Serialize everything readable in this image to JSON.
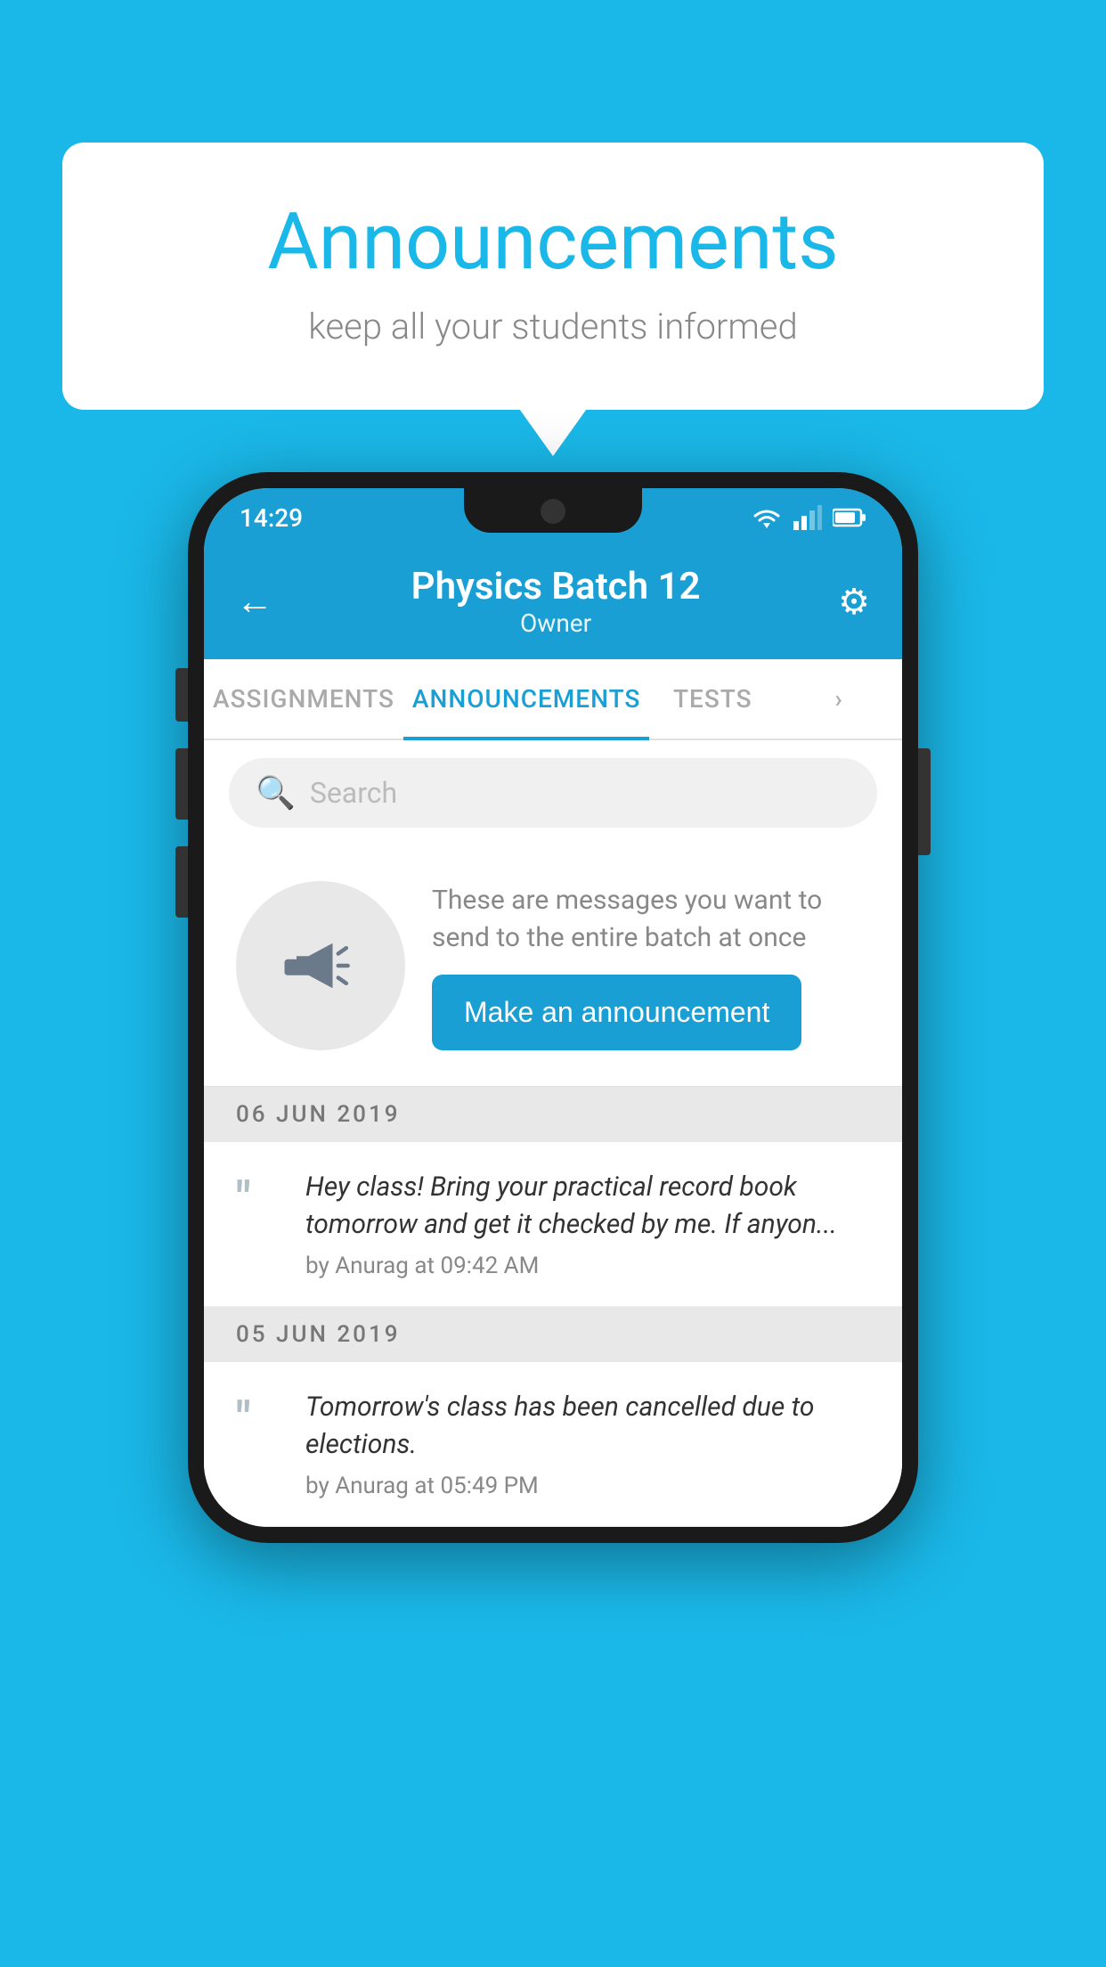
{
  "bubble": {
    "title": "Announcements",
    "subtitle": "keep all your students informed"
  },
  "status_bar": {
    "time": "14:29"
  },
  "app_bar": {
    "title": "Physics Batch 12",
    "subtitle": "Owner",
    "back_label": "←",
    "gear_label": "⚙"
  },
  "tabs": [
    {
      "label": "ASSIGNMENTS",
      "active": false
    },
    {
      "label": "ANNOUNCEMENTS",
      "active": true
    },
    {
      "label": "TESTS",
      "active": false
    },
    {
      "label": "...",
      "active": false
    }
  ],
  "search": {
    "placeholder": "Search"
  },
  "promo": {
    "description": "These are messages you want to send to the entire batch at once",
    "button_label": "Make an announcement"
  },
  "announcements": [
    {
      "date": "06  JUN  2019",
      "text": "Hey class! Bring your practical record book tomorrow and get it checked by me. If anyon...",
      "meta": "by Anurag at 09:42 AM"
    },
    {
      "date": "05  JUN  2019",
      "text": "Tomorrow's class has been cancelled due to elections.",
      "meta": "by Anurag at 05:49 PM"
    }
  ],
  "colors": {
    "accent": "#1a9fd4",
    "background": "#1ab8e8"
  }
}
